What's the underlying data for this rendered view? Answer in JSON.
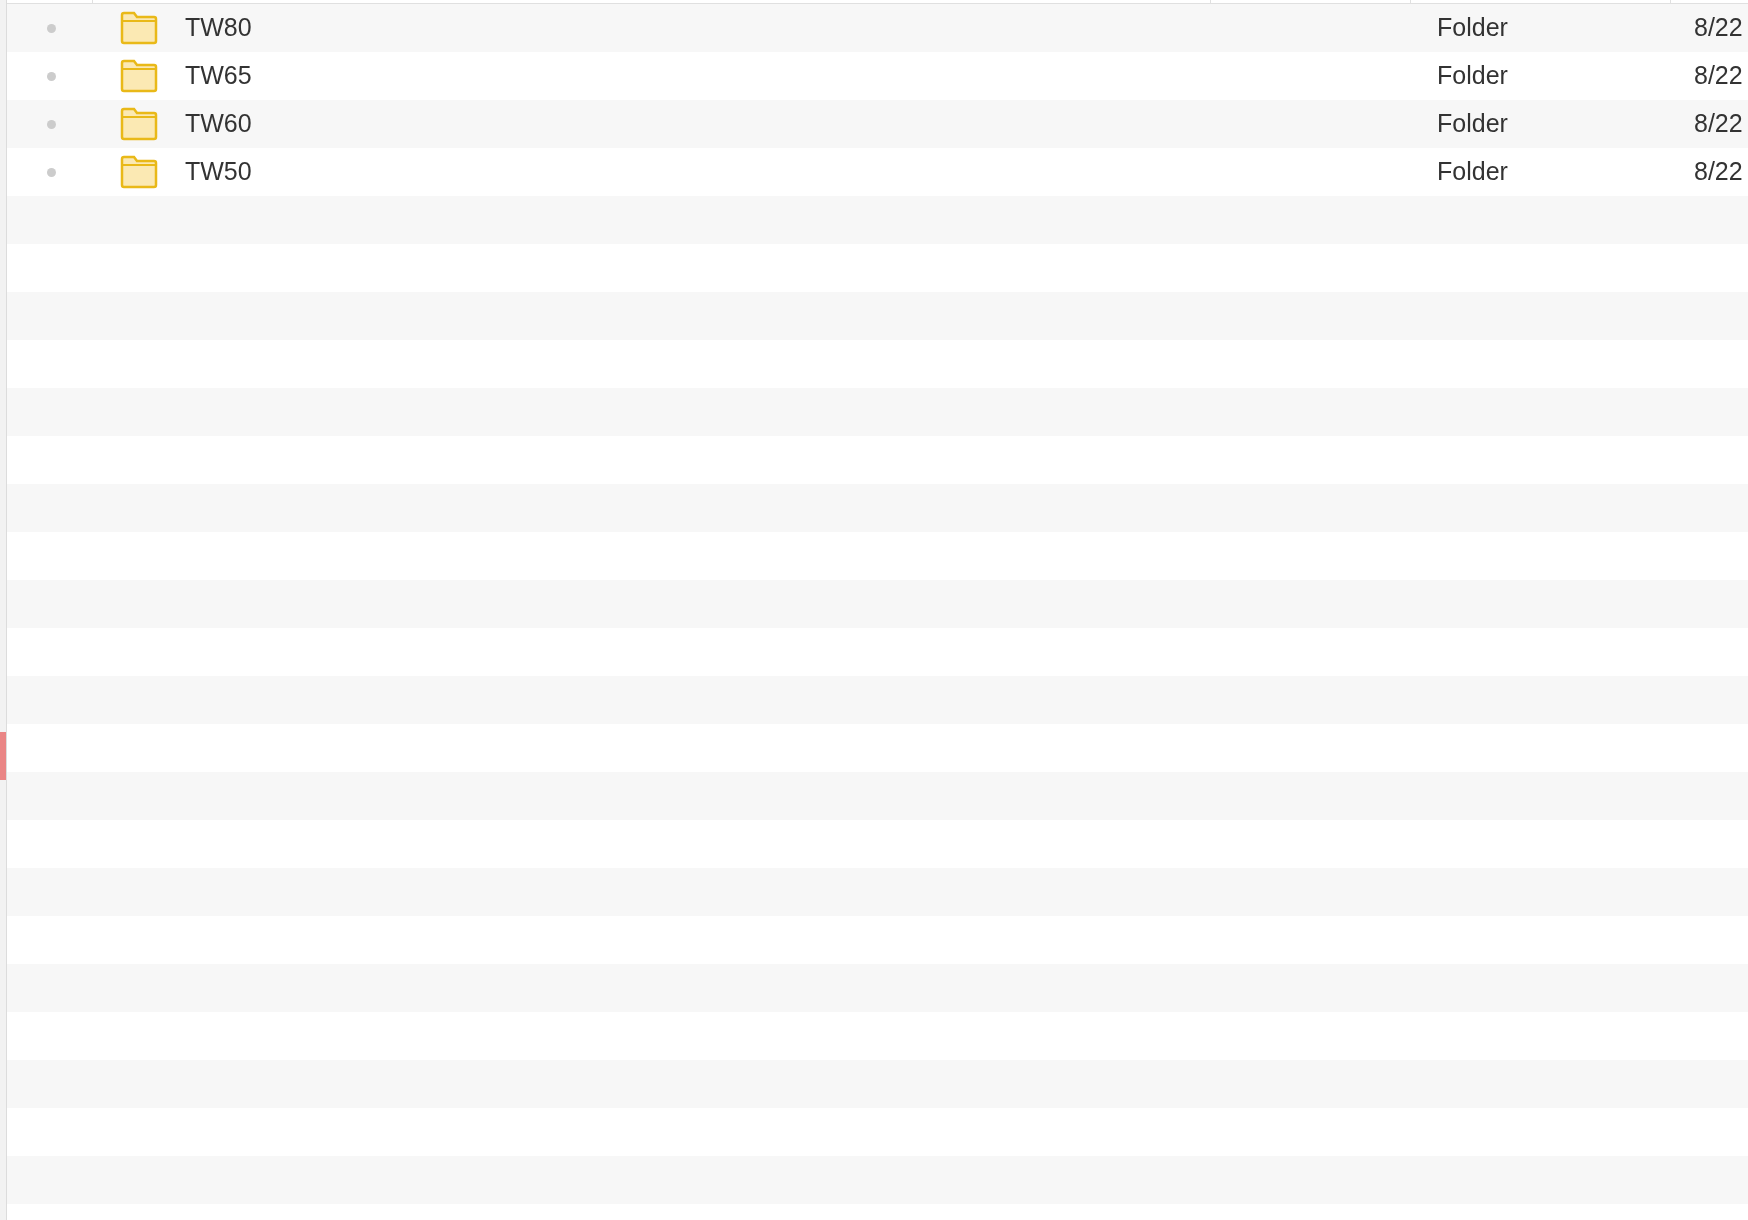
{
  "rows": [
    {
      "name": "TW80",
      "type": "Folder",
      "date": "8/22"
    },
    {
      "name": "TW65",
      "type": "Folder",
      "date": "8/22"
    },
    {
      "name": "TW60",
      "type": "Folder",
      "date": "8/22"
    },
    {
      "name": "TW50",
      "type": "Folder",
      "date": "8/22"
    }
  ]
}
